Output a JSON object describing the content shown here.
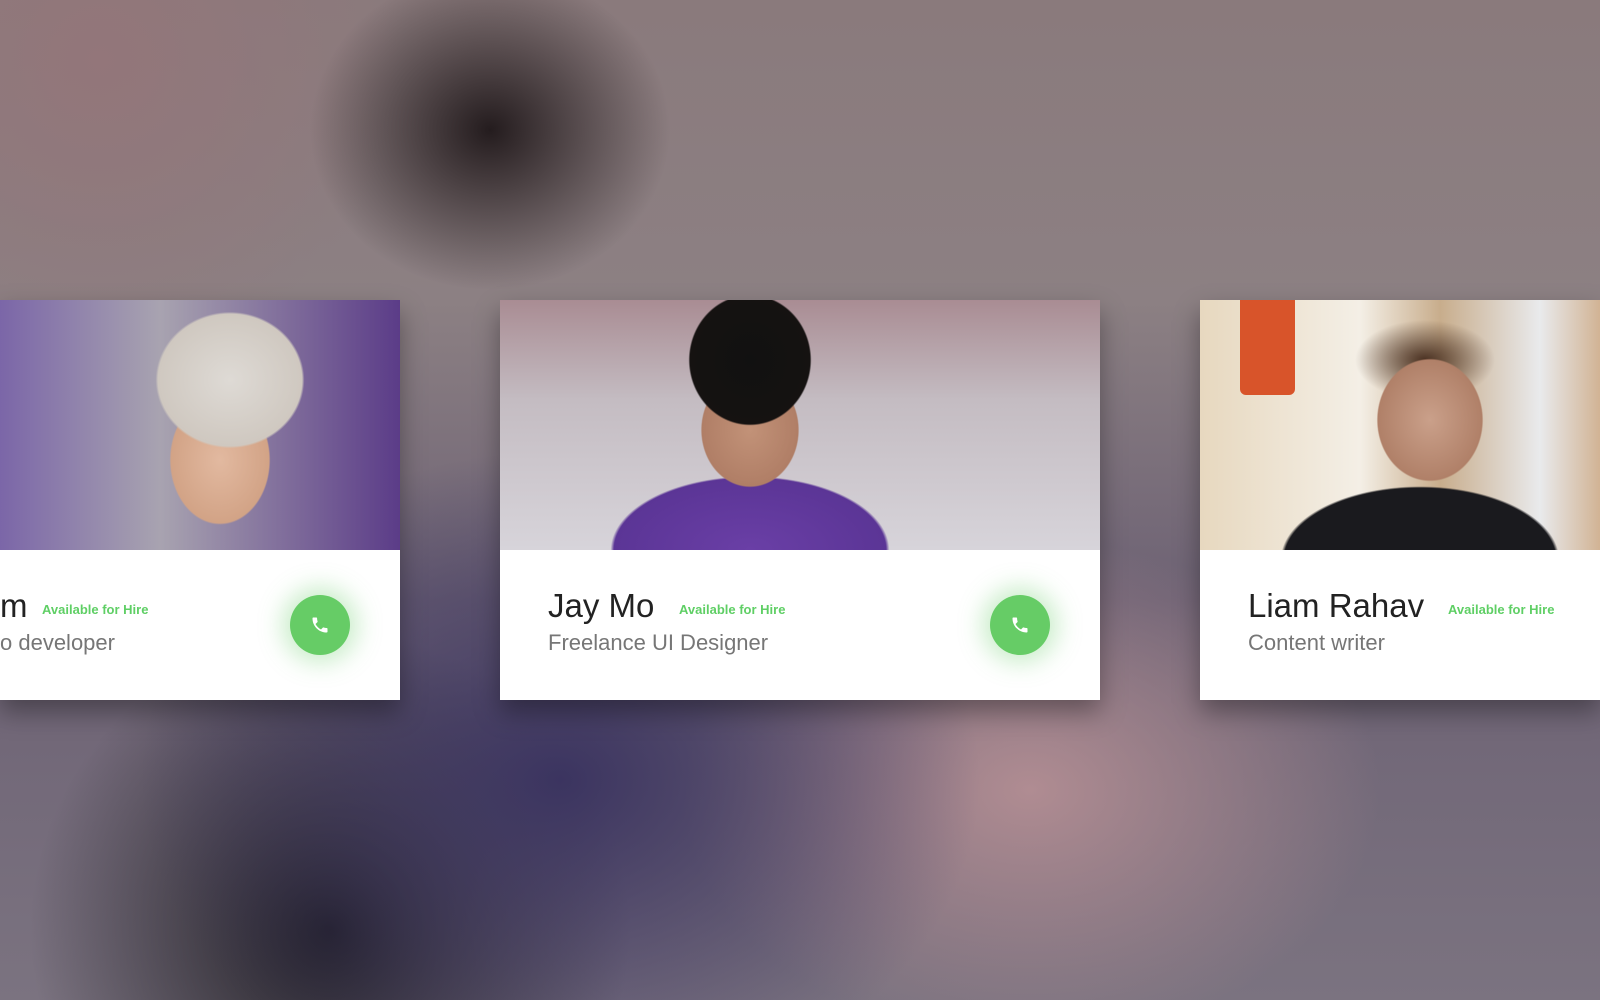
{
  "cards": [
    {
      "name": "m",
      "availability": "Available for Hire",
      "role": "o developer"
    },
    {
      "name": "Jay Mo",
      "availability": "Available for Hire",
      "role": "Freelance UI Designer"
    },
    {
      "name": "Liam Rahav",
      "availability": "Available for Hire",
      "role": "Content writer"
    }
  ],
  "icons": {
    "call": "phone-icon"
  },
  "colors": {
    "accent": "#66cc66",
    "available": "#5fcf65"
  }
}
